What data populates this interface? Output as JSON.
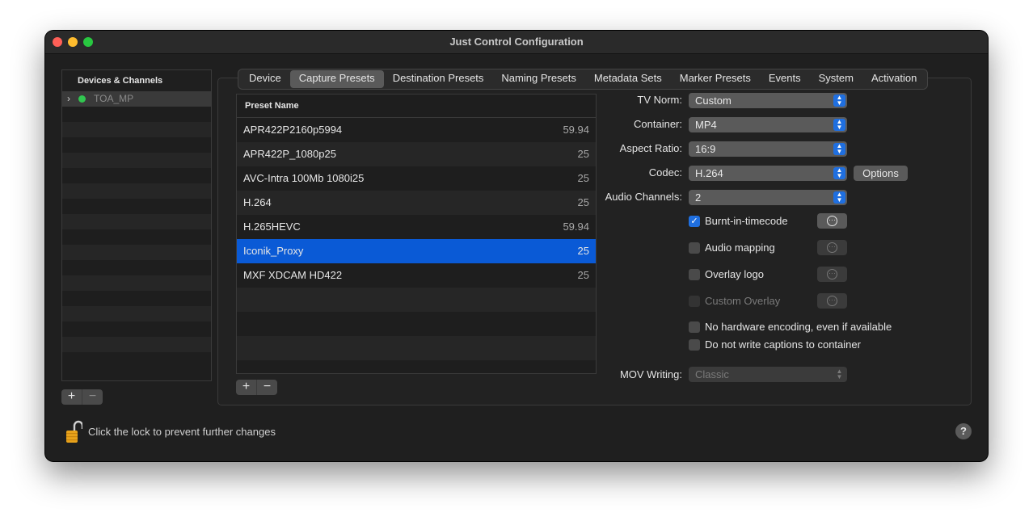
{
  "window": {
    "title": "Just Control Configuration"
  },
  "devices": {
    "header": "Devices & Channels",
    "items": [
      {
        "name": "TOA_MP",
        "status_color": "#31c650"
      }
    ],
    "add_label": "+",
    "remove_label": "−"
  },
  "tabs": [
    {
      "label": "Device"
    },
    {
      "label": "Capture Presets",
      "active": true
    },
    {
      "label": "Destination Presets"
    },
    {
      "label": "Naming Presets"
    },
    {
      "label": "Metadata Sets"
    },
    {
      "label": "Marker Presets"
    },
    {
      "label": "Events"
    },
    {
      "label": "System"
    },
    {
      "label": "Activation"
    }
  ],
  "presets": {
    "column_header": "Preset Name",
    "rows": [
      {
        "name": "APR422P2160p5994",
        "fps": "59.94"
      },
      {
        "name": "APR422P_1080p25",
        "fps": "25"
      },
      {
        "name": "AVC-Intra 100Mb 1080i25",
        "fps": "25"
      },
      {
        "name": "H.264",
        "fps": "25"
      },
      {
        "name": "H.265HEVC",
        "fps": "59.94"
      },
      {
        "name": "Iconik_Proxy",
        "fps": "25",
        "selected": true
      },
      {
        "name": "MXF XDCAM HD422",
        "fps": "25"
      }
    ],
    "add_label": "+",
    "remove_label": "−"
  },
  "form": {
    "tv_norm": {
      "label": "TV Norm:",
      "value": "Custom"
    },
    "container": {
      "label": "Container:",
      "value": "MP4"
    },
    "aspect_ratio": {
      "label": "Aspect Ratio:",
      "value": "16:9"
    },
    "codec": {
      "label": "Codec:",
      "value": "H.264",
      "options_label": "Options"
    },
    "audio_channels": {
      "label": "Audio Channels:",
      "value": "2"
    },
    "burnt_in_timecode": {
      "label": "Burnt-in-timecode",
      "checked": true
    },
    "audio_mapping": {
      "label": "Audio mapping",
      "checked": false
    },
    "overlay_logo": {
      "label": "Overlay logo",
      "checked": false
    },
    "custom_overlay": {
      "label": "Custom Overlay",
      "checked": false,
      "enabled": false
    },
    "no_hw_encoding": {
      "label": "No hardware encoding, even if available",
      "checked": false
    },
    "no_captions": {
      "label": "Do not write captions to container",
      "checked": false
    },
    "mov_writing": {
      "label": "MOV Writing:",
      "value": "Classic",
      "enabled": false
    }
  },
  "footer": {
    "lock_message": "Click the lock to prevent further changes",
    "help_label": "?"
  },
  "colors": {
    "accent": "#0a5ad6",
    "checkbox_accent": "#1f6fe0",
    "status_green": "#31c650"
  }
}
